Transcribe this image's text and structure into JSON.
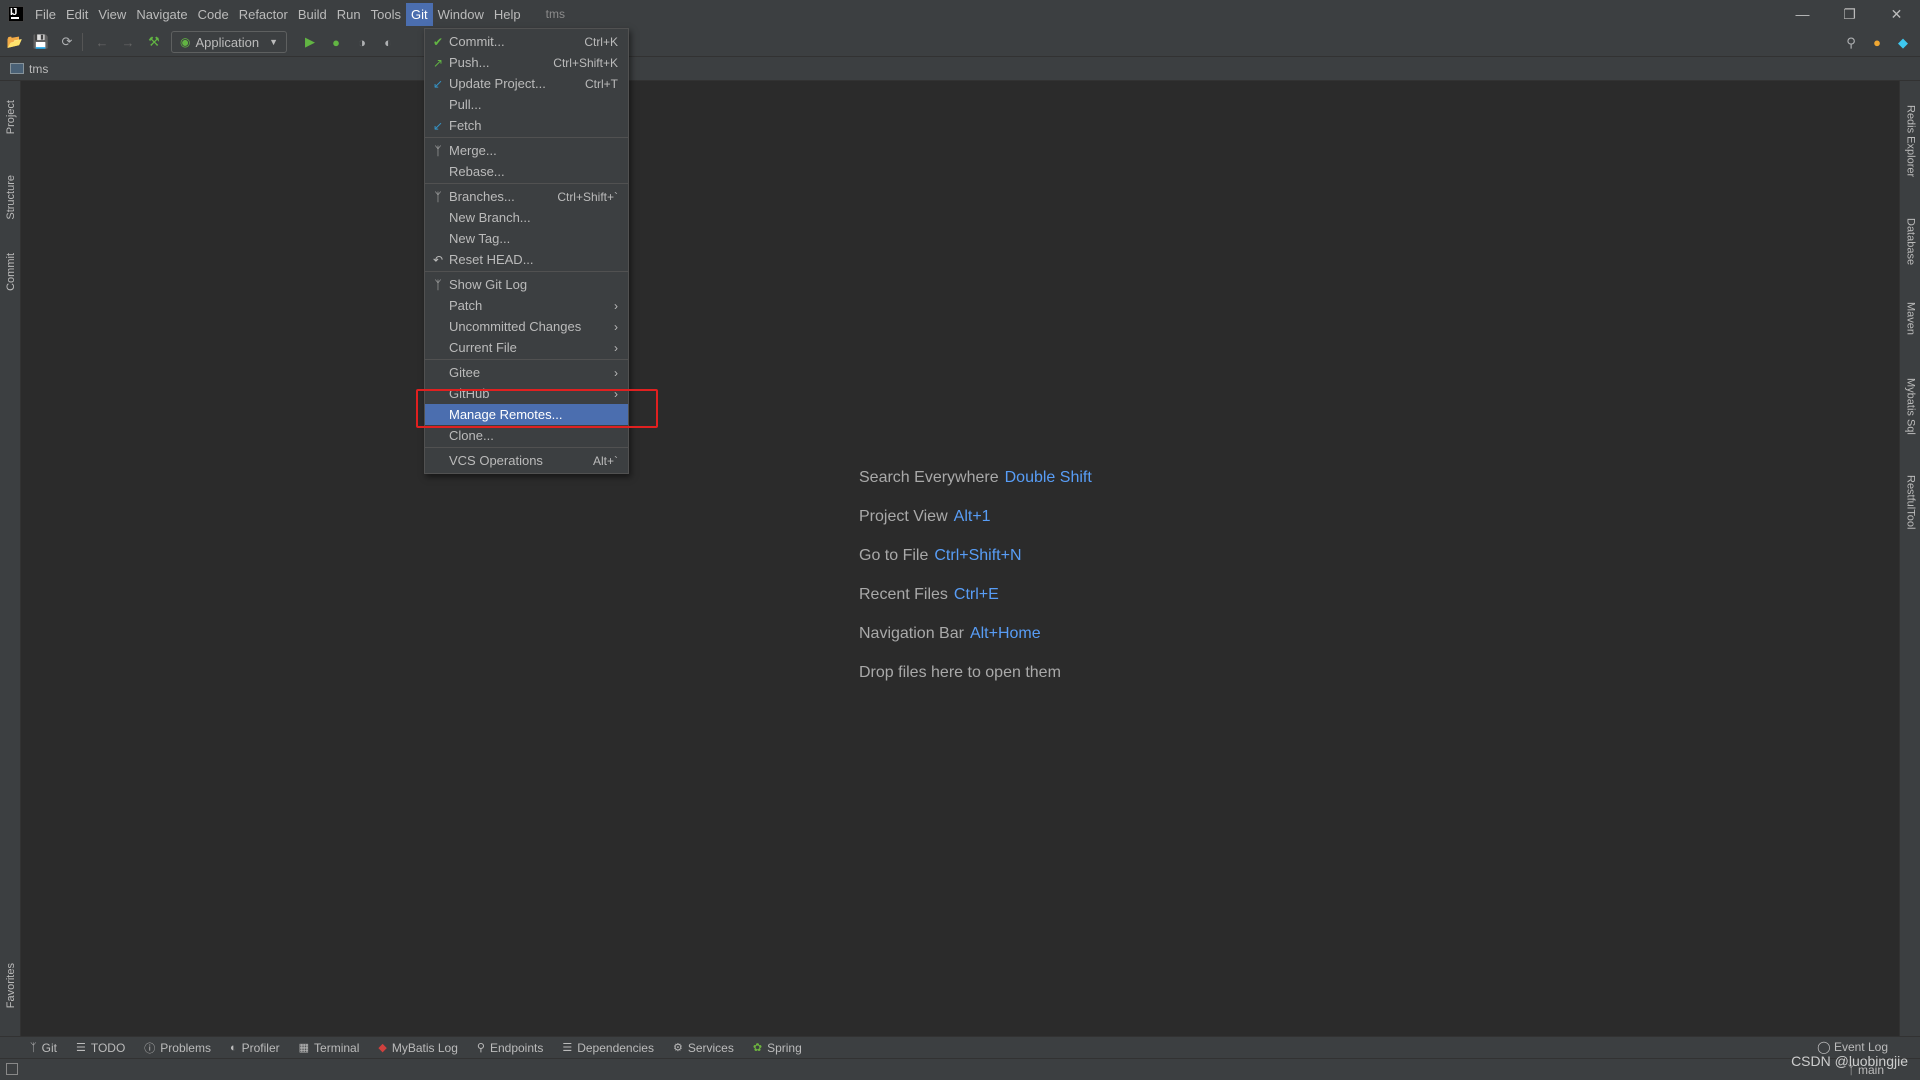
{
  "menubar": {
    "items": [
      "File",
      "Edit",
      "View",
      "Navigate",
      "Code",
      "Refactor",
      "Build",
      "Run",
      "Tools",
      "Git",
      "Window",
      "Help"
    ],
    "project_title": "tms"
  },
  "toolbar": {
    "run_config": "Application"
  },
  "navbar": {
    "project": "tms"
  },
  "git_menu": {
    "items": [
      {
        "label": "Commit...",
        "accel": "Ctrl+K",
        "icon": "check-icon"
      },
      {
        "label": "Push...",
        "accel": "Ctrl+Shift+K",
        "icon": "push-arrow-icon"
      },
      {
        "label": "Update Project...",
        "accel": "Ctrl+T",
        "icon": "update-arrow-icon"
      },
      {
        "label": "Pull...",
        "accel": "",
        "icon": ""
      },
      {
        "label": "Fetch",
        "accel": "",
        "icon": "fetch-icon"
      },
      {
        "label": "Merge...",
        "accel": "",
        "icon": "merge-icon"
      },
      {
        "label": "Rebase...",
        "accel": "",
        "icon": ""
      },
      {
        "label": "Branches...",
        "accel": "Ctrl+Shift+`",
        "icon": "branch-icon"
      },
      {
        "label": "New Branch...",
        "accel": "",
        "icon": ""
      },
      {
        "label": "New Tag...",
        "accel": "",
        "icon": ""
      },
      {
        "label": "Reset HEAD...",
        "accel": "",
        "icon": "undo-icon"
      },
      {
        "label": "Show Git Log",
        "accel": "",
        "icon": "branch-icon"
      },
      {
        "label": "Patch",
        "accel": "",
        "icon": ""
      },
      {
        "label": "Uncommitted Changes",
        "accel": "",
        "icon": ""
      },
      {
        "label": "Current File",
        "accel": "",
        "icon": ""
      },
      {
        "label": "Gitee",
        "accel": "",
        "icon": ""
      },
      {
        "label": "GitHub",
        "accel": "",
        "icon": ""
      },
      {
        "label": "Manage Remotes...",
        "accel": "",
        "icon": ""
      },
      {
        "label": "Clone...",
        "accel": "",
        "icon": ""
      },
      {
        "label": "VCS Operations",
        "accel": "Alt+`",
        "icon": ""
      }
    ]
  },
  "left_strip": [
    "Project",
    "Structure",
    "Commit",
    "Favorites"
  ],
  "right_strip": [
    "Redis Explorer",
    "Database",
    "Maven",
    "Mybatis Sql",
    "RestfulTool"
  ],
  "hints": [
    {
      "label": "Search Everywhere",
      "shortcut": "Double Shift"
    },
    {
      "label": "Project View",
      "shortcut": "Alt+1"
    },
    {
      "label": "Go to File",
      "shortcut": "Ctrl+Shift+N"
    },
    {
      "label": "Recent Files",
      "shortcut": "Ctrl+E"
    },
    {
      "label": "Navigation Bar",
      "shortcut": "Alt+Home"
    },
    {
      "label": "Drop files here to open them",
      "shortcut": ""
    }
  ],
  "bottom_bar": {
    "items": [
      "Git",
      "TODO",
      "Problems",
      "Profiler",
      "Terminal",
      "MyBatis Log",
      "Endpoints",
      "Dependencies",
      "Services",
      "Spring"
    ],
    "event_log": "Event Log"
  },
  "status_bar": {
    "branch": "main"
  },
  "watermark": "CSDN @luobingjie",
  "colors": {
    "accent": "#4b6eaf",
    "shortcut": "#589df6",
    "highlight_box": "#e02020",
    "background": "#2b2b2b"
  }
}
